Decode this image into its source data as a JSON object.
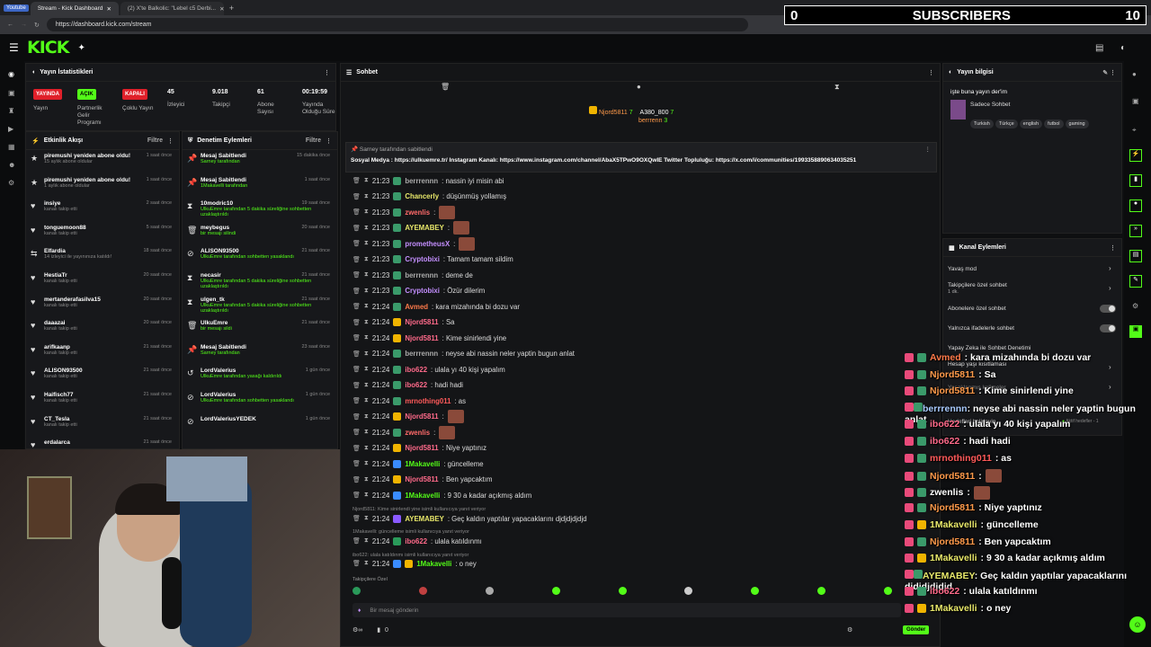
{
  "browser": {
    "yt_badge": "Youtube",
    "tabs": [
      "Stream - Kick Dashboard",
      "(2) X'te Balkolic: \"Lebel c5 Derbi..."
    ],
    "url": "https://dashboard.kick.com/stream",
    "new_tab": "+"
  },
  "subscribers": {
    "count_left": "0",
    "label": "SUBSCRIBERS",
    "count_right": "10"
  },
  "app": {
    "logo": "KICK"
  },
  "stats": {
    "title": "Yayın İstatistikleri",
    "yayin_badge": "YAYINDA",
    "yayin_label": "Yayın",
    "partner_badge": "AÇIK",
    "partner_label": "Partnerlik Gelir Programı",
    "coklu_badge": "KAPALI",
    "coklu_label": "Çoklu Yayın",
    "izleyici_value": "45",
    "izleyici_label": "İzleyici",
    "takipci_value": "9.018",
    "takipci_label": "Takipçi",
    "abone_value": "61",
    "abone_label": "Abone Sayısı",
    "sure_value": "00:19:59",
    "sure_label": "Yayında Olduğu Süre"
  },
  "activity": {
    "title": "Etkinlik Akışı",
    "filter": "Filtre",
    "items": [
      {
        "t": "piremushi yeniden abone oldu!",
        "s": "15 aylık abone oldular",
        "time": "1 saat önce"
      },
      {
        "t": "piremushi yeniden abone oldu!",
        "s": "1 aylık abone oldular",
        "time": "1 saat önce"
      },
      {
        "t": "insiye",
        "s": "kanalı takip etti",
        "time": "2 saat önce"
      },
      {
        "t": "tonguemoon88",
        "s": "kanalı takip etti",
        "time": "5 saat önce"
      },
      {
        "t": "Elfardia",
        "s": "14 izleyici ile yayınınıza katıldı!",
        "time": "18 saat önce"
      },
      {
        "t": "HestiaTr",
        "s": "kanalı takip etti",
        "time": "20 saat önce"
      },
      {
        "t": "mertanderafasilva15",
        "s": "kanalı takip etti",
        "time": "20 saat önce"
      },
      {
        "t": "daaazai",
        "s": "kanalı takip etti",
        "time": "20 saat önce"
      },
      {
        "t": "arifkaanp",
        "s": "kanalı takip etti",
        "time": "21 saat önce"
      },
      {
        "t": "ALISON93500",
        "s": "kanalı takip etti",
        "time": "21 saat önce"
      },
      {
        "t": "Haifisch77",
        "s": "kanalı takip etti",
        "time": "21 saat önce"
      },
      {
        "t": "CT_Tesla",
        "s": "kanalı takip etti",
        "time": "21 saat önce"
      },
      {
        "t": "erdalarca",
        "s": "",
        "time": "21 saat önce"
      }
    ]
  },
  "moderation": {
    "title": "Denetim Eylemleri",
    "filter": "Filtre",
    "items": [
      {
        "t": "Mesaj Sabitlendi",
        "s": "Sarney tarafından",
        "time": "15 dakika önce"
      },
      {
        "t": "Mesaj Sabitlendi",
        "s": "1Makavelli tarafından",
        "time": "1 saat önce"
      },
      {
        "t": "10modric10",
        "s": "UlkuEmre tarafından 5 dakika süreliğine sohbetten uzaklaştırıldı",
        "time": "19 saat önce"
      },
      {
        "t": "meybegus",
        "s": "bir mesajı silindi",
        "time": "20 saat önce"
      },
      {
        "t": "ALISON93500",
        "s": "UlkuEmre tarafından sohbetten yasaklandı",
        "time": "21 saat önce"
      },
      {
        "t": "necasir",
        "s": "UlkuEmre tarafından 5 dakika süreliğine sohbetten uzaklaştırıldı",
        "time": "21 saat önce"
      },
      {
        "t": "ulgen_tk",
        "s": "UlkuEmre tarafından 5 dakika süreliğine sohbetten uzaklaştırıldı",
        "time": "21 saat önce"
      },
      {
        "t": "UlkuEmre",
        "s": "bir mesajı sildi",
        "time": "21 saat önce"
      },
      {
        "t": "Mesaj Sabitlendi",
        "s": "Sarney tarafından",
        "time": "23 saat önce"
      },
      {
        "t": "LordValerius",
        "s": "UlkuEmre tarafından yasağı kaldırıldı",
        "time": "1 gün önce"
      },
      {
        "t": "LordValerius",
        "s": "UlkuEmre tarafından sohbetten yasaklandı",
        "time": "1 gün önce"
      },
      {
        "t": "LordValeriusYEDEK",
        "s": "",
        "time": "1 gün önce"
      }
    ]
  },
  "chat": {
    "title": "Sohbet",
    "top_gifter1": "Njord5811",
    "top_gifter1_count": "7",
    "top_gifter2": "A380_800",
    "top_gifter2_count": "7",
    "top_gifter3": "berrrenn",
    "top_gifter3_count": "3",
    "pinned_by": "Sarney tarafından sabitlendi",
    "pinned_text": "Sosyal Medya : https://ulkuemre.tr/ Instagram Kanalı: https://www.instagram.com/channel/AbaX5TPwO9OXQwIE Twitter Topluluğu: https://x.com/i/communities/1993358890634035251",
    "messages": [
      {
        "time": "21:23",
        "user": "berrrennn",
        "color": "#aaaaaa",
        "text": ": nassin iyi misin abi"
      },
      {
        "time": "21:23",
        "user": "Chancerly",
        "color": "#e8e86a",
        "text": ": düşünmüş yollamış"
      },
      {
        "time": "21:23",
        "user": "zwenlis",
        "color": "#ff6a6a",
        "text": ":"
      },
      {
        "time": "21:23",
        "user": "AYEMABEY",
        "color": "#e8e86a",
        "text": ":"
      },
      {
        "time": "21:23",
        "user": "prometheusX",
        "color": "#c48fff",
        "text": ":"
      },
      {
        "time": "21:23",
        "user": "Cryptobixi",
        "color": "#c48fff",
        "text": ": Tamam tamam sildim"
      },
      {
        "time": "21:23",
        "user": "berrrennn",
        "color": "#aaaaaa",
        "text": ": deme de"
      },
      {
        "time": "21:23",
        "user": "Cryptobixi",
        "color": "#c48fff",
        "text": ": Özür dilerim"
      },
      {
        "time": "21:24",
        "user": "Avmed",
        "color": "#ff7a4a",
        "text": ": kara mizahında bi dozu var"
      },
      {
        "time": "21:24",
        "user": "Njord5811",
        "color": "#ff6a8a",
        "text": ": Sa"
      },
      {
        "time": "21:24",
        "user": "Njord5811",
        "color": "#ff6a8a",
        "text": ": Kime sinirlendi yine"
      },
      {
        "time": "21:24",
        "user": "berrrennn",
        "color": "#aaaaaa",
        "text": ": neyse abi nassin neler yaptin bugun anlat"
      },
      {
        "time": "21:24",
        "user": "ibo622",
        "color": "#ff6a8a",
        "text": ": ulala yı 40 kişi yapalım"
      },
      {
        "time": "21:24",
        "user": "ibo622",
        "color": "#ff6a8a",
        "text": ": hadi hadi"
      },
      {
        "time": "21:24",
        "user": "mrnothing011",
        "color": "#ff5a5a",
        "text": ": as"
      },
      {
        "time": "21:24",
        "user": "Njord5811",
        "color": "#ff6a8a",
        "text": ":"
      },
      {
        "time": "21:24",
        "user": "zwenlis",
        "color": "#ff6a6a",
        "text": ":"
      },
      {
        "time": "21:24",
        "user": "Njord5811",
        "color": "#ff6a8a",
        "text": ": Niye yaptınız"
      },
      {
        "time": "21:24",
        "user": "1Makavelli",
        "color": "#53fc18",
        "text": ": güncelleme"
      },
      {
        "time": "21:24",
        "user": "Njord5811",
        "color": "#ff6a8a",
        "text": ": Ben yapcaktım"
      },
      {
        "time": "21:24",
        "user": "1Makavelli",
        "color": "#53fc18",
        "text": ": 9 30 a kadar açıkmış aldım"
      }
    ],
    "reply1": "Njord5811: Kime sinirlendi yine isimli kullanıcıya yanıt veriyor",
    "msg_reply1": {
      "time": "21:24",
      "user": "AYEMABEY",
      "color": "#e8e86a",
      "text": ": Geç kaldın yaptılar yapacaklarını djdjdjdjdjd"
    },
    "reply2": "1Makavelli: güncelleme isimli kullanıcıya yanıt veriyor",
    "msg_reply2": {
      "time": "21:24",
      "user": "ibo622",
      "color": "#ff6a8a",
      "text": ": ulala katıldınmı"
    },
    "reply3": "ibo622: ulala katıldınmı isimli kullanıcıya yanıt veriyor",
    "msg_reply3": {
      "time": "21:24",
      "user": "1Makavelli",
      "color": "#53fc18",
      "text": ": o ney"
    },
    "followers_only": "Takipçilere Özel",
    "input_placeholder": "Bir mesaj gönderin",
    "count": "0",
    "send": "Gönder"
  },
  "stream_info": {
    "title": "Yayın bilgisi",
    "stream_title": "işte buna yayın der'im",
    "category": "Sadece Sohbet",
    "tags": [
      "Turkish",
      "Türkçe",
      "english",
      "futbol",
      "gaming"
    ]
  },
  "channel_actions": {
    "title": "Kanal Eylemleri",
    "items": [
      "Yavaş mod",
      "Takipçilere özel sohbet",
      "Abonelere özel sohbet",
      "Yalnızca ifadelerle sohbet",
      "Yapay Zeka ile Sohbet Denetimi",
      "Hesap yaşı kısıtlaması",
      "Yasaklanmış kelimeler",
      "Hedefleri belirleyin"
    ],
    "takip_sub": "1 dk.",
    "goals_status": "Aktif hedefler - 1"
  },
  "overlay": [
    {
      "user": "Avmed",
      "color": "#ff7a4a",
      "text": ": kara mizahında bi dozu var"
    },
    {
      "user": "Njord5811",
      "color": "#ff9a4a",
      "text": ": Sa"
    },
    {
      "user": "Njord5811",
      "color": "#ff9a4a",
      "text": ": Kime sinirlendi yine"
    },
    {
      "user": "berrrennn",
      "color": "#aaccff",
      "text": ": neyse abi nassin neler yaptin bugun anlat"
    },
    {
      "user": "ibo622",
      "color": "#ff6a8a",
      "text": ": ulala yı 40 kişi yapalım"
    },
    {
      "user": "ibo622",
      "color": "#ff6a8a",
      "text": ": hadi hadi"
    },
    {
      "user": "mrnothing011",
      "color": "#ff5a5a",
      "text": ": as"
    },
    {
      "user": "Njord5811",
      "color": "#ff9a4a",
      "text": ":"
    },
    {
      "user": "zwenlis",
      "color": "#ffffff",
      "text": ":"
    },
    {
      "user": "Njord5811",
      "color": "#ff9a4a",
      "text": ": Niye yaptınız"
    },
    {
      "user": "1Makavelli",
      "color": "#e8e86a",
      "text": ": güncelleme"
    },
    {
      "user": "Njord5811",
      "color": "#ff9a4a",
      "text": ": Ben yapcaktım"
    },
    {
      "user": "1Makavelli",
      "color": "#e8e86a",
      "text": ": 9 30 a kadar açıkmış aldım"
    },
    {
      "user": "AYEMABEY",
      "color": "#e8e86a",
      "text": ": Geç kaldın yaptılar yapacaklarını djdjdjdjdjd"
    },
    {
      "user": "ibo622",
      "color": "#ff6a8a",
      "text": ": ulala katıldınmı"
    },
    {
      "user": "1Makavelli",
      "color": "#e8e86a",
      "text": ": o ney"
    }
  ]
}
